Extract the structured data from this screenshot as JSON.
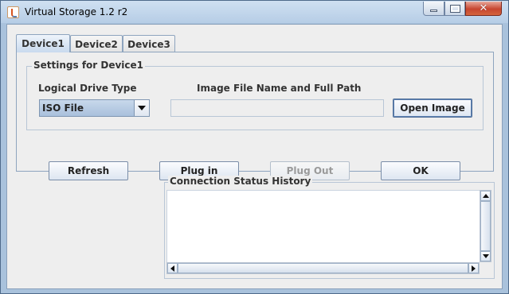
{
  "window": {
    "title": "Virtual Storage 1.2 r2",
    "icon": "java-cup-icon",
    "controls": {
      "minimize": "minimize-icon",
      "maximize": "maximize-icon",
      "close": "close-icon"
    }
  },
  "tabs": [
    {
      "label": "Device1",
      "active": true
    },
    {
      "label": "Device2",
      "active": false
    },
    {
      "label": "Device3",
      "active": false
    }
  ],
  "settings": {
    "group_title": "Settings for Device1",
    "drive_type_label": "Logical Drive Type",
    "drive_type_value": "ISO File",
    "image_path_label": "Image File Name and Full Path",
    "image_path_value": "",
    "open_image_label": "Open Image"
  },
  "actions": {
    "refresh_label": "Refresh",
    "plug_in_label": "Plug in",
    "plug_out_label": "Plug Out",
    "plug_out_enabled": false,
    "ok_label": "OK"
  },
  "status": {
    "title": "Connection Status History",
    "content": ""
  },
  "colors": {
    "title_bar": "#b6cde6",
    "combo_selected": "#a9c0dc",
    "close_button": "#c7452f"
  }
}
